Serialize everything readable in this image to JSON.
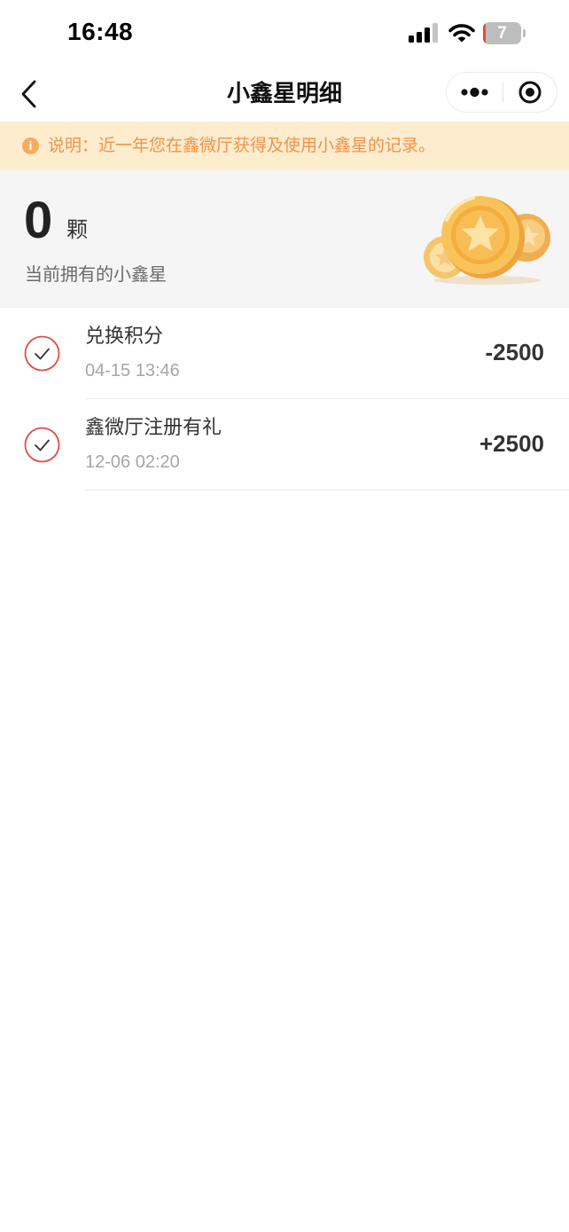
{
  "status_bar": {
    "time": "16:48",
    "battery_level": "7",
    "battery_fraction": 0.07,
    "icons": [
      "signal-icon",
      "wifi-icon",
      "battery-icon"
    ]
  },
  "nav": {
    "title": "小鑫星明细",
    "icons": [
      "back-icon",
      "more-dots-icon",
      "close-target-icon"
    ]
  },
  "notice": {
    "icon": "info-icon",
    "icon_glyph": "i",
    "text": "说明：近一年您在鑫微厅获得及使用小鑫星的记录。"
  },
  "balance": {
    "count": "0",
    "unit": "颗",
    "caption": "当前拥有的小鑫星",
    "illustration": "gold-star-coins-illustration"
  },
  "records": [
    {
      "title": "兑换积分",
      "time": "04-15 13:46",
      "amount": "-2500",
      "icon": "check-circle-icon"
    },
    {
      "title": "鑫微厅注册有礼",
      "time": "12-06 02:20",
      "amount": "+2500",
      "icon": "check-circle-icon"
    }
  ],
  "colors": {
    "notice_background": "#fdeccd",
    "notice_text": "#f0944a",
    "check_ring": "#e04d45",
    "balance_background": "#f5f5f5",
    "coin_gold": "#f6b64a"
  }
}
